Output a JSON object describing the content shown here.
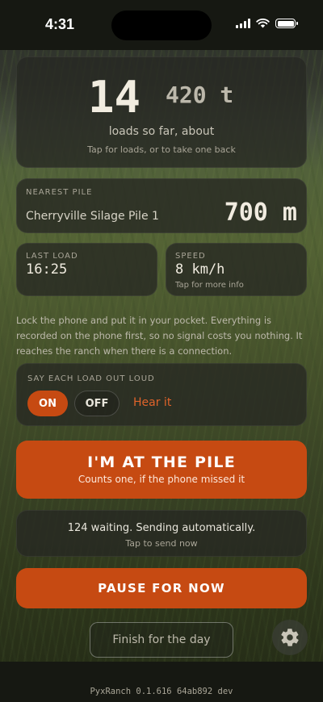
{
  "status_bar": {
    "time": "4:31"
  },
  "loads": {
    "count": "14",
    "tons": "420 t",
    "subtitle": "loads so far, about",
    "hint": "Tap for loads, or to take one back"
  },
  "nearest_pile": {
    "caption": "NEAREST PILE",
    "name": "Cherryville Silage Pile 1",
    "distance": "700 m"
  },
  "last_load": {
    "caption": "LAST LOAD",
    "value": "16:25"
  },
  "speed": {
    "caption": "SPEED",
    "value": "8 km/h",
    "hint": "Tap for more info"
  },
  "note": "Lock the phone and put it in your pocket. Everything is recorded on the phone first, so no signal costs you nothing. It reaches the ranch when there is a connection.",
  "speak": {
    "caption": "SAY EACH LOAD OUT LOUD",
    "on_label": "ON",
    "off_label": "OFF",
    "hear_label": "Hear it",
    "selected": "ON"
  },
  "at_pile_button": {
    "title": "I'M AT THE PILE",
    "subtitle": "Counts one, if the phone missed it"
  },
  "sync": {
    "status": "124 waiting. Sending automatically.",
    "hint": "Tap to send now"
  },
  "pause_button": {
    "label": "PAUSE FOR NOW"
  },
  "finish_button": {
    "label": "Finish for the day"
  },
  "settings_icon": "gear-icon",
  "footer": {
    "version": "PyxRanch 0.1.616 64ab892 dev"
  },
  "colors": {
    "accent": "#c64a12",
    "accent_text": "#e0632a",
    "background": "#161812"
  }
}
